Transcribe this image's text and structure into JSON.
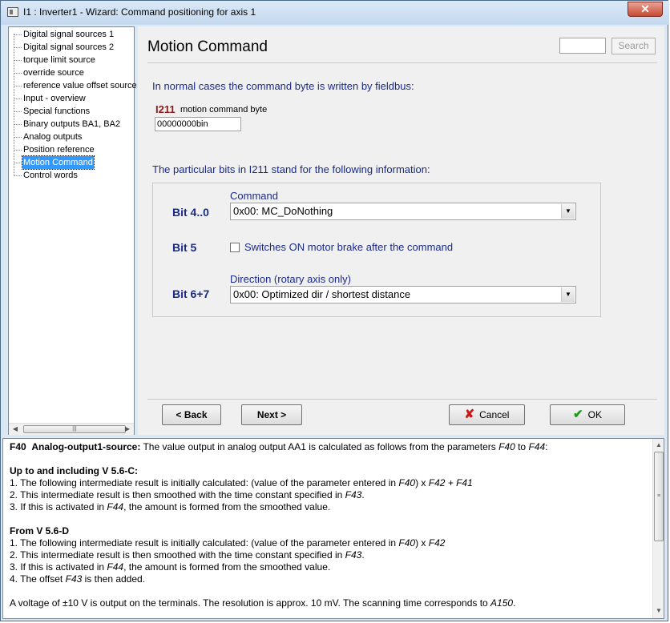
{
  "window": {
    "title": "I1 : Inverter1 - Wizard: Command positioning for axis 1",
    "close_glyph": "✕"
  },
  "tree": {
    "items": [
      {
        "label": "Digital signal sources 1"
      },
      {
        "label": "Digital signal sources 2"
      },
      {
        "label": "torque limit source"
      },
      {
        "label": "override source"
      },
      {
        "label": "reference value offset source"
      },
      {
        "label": "Input - overview"
      },
      {
        "label": "Special functions"
      },
      {
        "label": "Binary outputs BA1, BA2"
      },
      {
        "label": "Analog outputs"
      },
      {
        "label": "Position reference"
      },
      {
        "label": "Motion Command",
        "selected": true
      },
      {
        "label": "Control words"
      }
    ],
    "scroll_left": "◀",
    "scroll_right": "▶",
    "scroll_grip": "|||"
  },
  "main": {
    "title": "Motion Command",
    "search_value": "",
    "search_label": "Search",
    "info_fieldbus": "In normal cases the command byte is written by fieldbus:",
    "param": {
      "id": "I211",
      "label": "motion command byte",
      "value": "00000000bin"
    },
    "info_bits": "The particular bits in I211 stand for the following information:",
    "bits": {
      "bit40": {
        "label": "Bit 4..0",
        "caption": "Command",
        "value": "0x00: MC_DoNothing"
      },
      "bit5": {
        "label": "Bit 5",
        "checkbox_label": "Switches ON motor brake after the command",
        "checked": false
      },
      "bit67": {
        "label": "Bit 6+7",
        "caption": "Direction (rotary axis only)",
        "value": "0x00: Optimized dir / shortest distance"
      }
    },
    "dropdown_arrow": "▼",
    "buttons": {
      "back": "< Back",
      "next": "Next >",
      "cancel": "Cancel",
      "ok": "OK",
      "cancel_icon": "✘",
      "ok_icon": "✔"
    }
  },
  "help": {
    "heading_code": "F40",
    "heading_title": "Analog-output1-source:",
    "heading_rest_a": " The value output in analog output AA1 is calculated as follows from the parameters ",
    "heading_p1": "F40",
    "heading_rest_b": " to ",
    "heading_p2": "F44",
    "heading_rest_c": ":",
    "sec1_title": "Up to and including V 5.6-C:",
    "sec1_l1a": "1. The following intermediate result is initially calculated: (value of the parameter entered in ",
    "sec1_l1b": "F40",
    "sec1_l1c": ") x ",
    "sec1_l1d": "F42 + F41",
    "sec1_l2a": "2. This intermediate result is then smoothed with the time constant specified in ",
    "sec1_l2b": "F43",
    "sec1_l2c": ".",
    "sec1_l3a": "3. If this is activated in ",
    "sec1_l3b": "F44",
    "sec1_l3c": ", the amount is formed from the smoothed value.",
    "sec2_title": "From V 5.6-D",
    "sec2_l1a": "1. The following intermediate result is initially calculated: (value of the parameter entered in ",
    "sec2_l1b": "F40",
    "sec2_l1c": ") x ",
    "sec2_l1d": "F42",
    "sec2_l2a": "2. This intermediate result is then smoothed with the time constant specified in ",
    "sec2_l2b": "F43",
    "sec2_l2c": ".",
    "sec2_l3a": "3. If this is activated in ",
    "sec2_l3b": "F44",
    "sec2_l3c": ", the amount is formed from the smoothed value.",
    "sec2_l4a": "4. The offset ",
    "sec2_l4b": "F43",
    "sec2_l4c": " is then added.",
    "footer_a": "A voltage of ±10 V is output on the terminals. The resolution is approx. 10 mV. The scanning time corresponds to ",
    "footer_b": "A150",
    "footer_c": ".",
    "scroll_up": "▲",
    "scroll_down": "▼",
    "scroll_grip": "≡"
  }
}
